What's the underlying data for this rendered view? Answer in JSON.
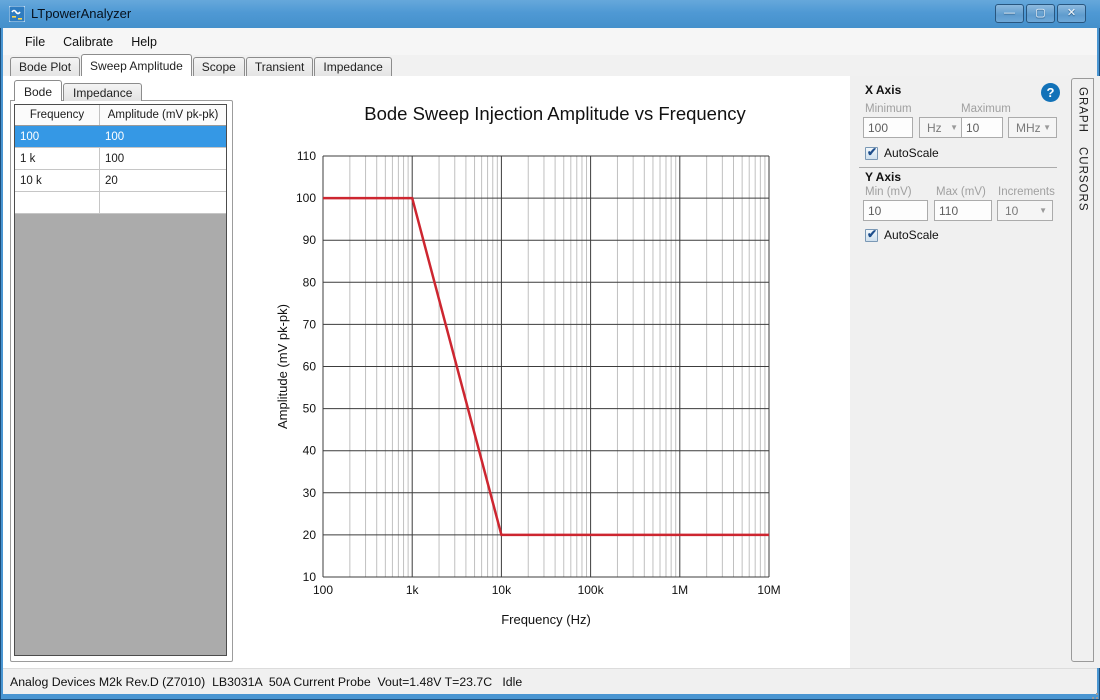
{
  "window": {
    "title": "LTpowerAnalyzer",
    "controls": [
      {
        "name": "minimize",
        "glyph": "—"
      },
      {
        "name": "maximize",
        "glyph": "▢"
      },
      {
        "name": "close",
        "glyph": "✕"
      }
    ]
  },
  "menu": {
    "items": [
      "File",
      "Calibrate",
      "Help"
    ]
  },
  "main_tabs": {
    "items": [
      "Bode Plot",
      "Sweep Amplitude",
      "Scope",
      "Transient",
      "Impedance"
    ],
    "active": "Sweep Amplitude"
  },
  "left_panel": {
    "tabs": [
      "Bode",
      "Impedance"
    ],
    "active_tab": "Bode",
    "table": {
      "headers": [
        "Frequency",
        "Amplitude (mV pk-pk)"
      ],
      "rows": [
        [
          "100",
          "100"
        ],
        [
          "1 k",
          "100"
        ],
        [
          "10 k",
          "20"
        ],
        [
          "",
          ""
        ]
      ],
      "selected_row_index": 0
    }
  },
  "chart_data": {
    "type": "line",
    "title": "Bode Sweep Injection Amplitude vs Frequency",
    "xlabel": "Frequency (Hz)",
    "ylabel": "Amplitude (mV pk-pk)",
    "xscale": "log",
    "xlim": [
      100,
      10000000
    ],
    "ylim": [
      10,
      110
    ],
    "y_increment": 10,
    "xticks": {
      "values": [
        100,
        1000,
        10000,
        100000,
        1000000,
        10000000
      ],
      "labels": [
        "100",
        "1k",
        "10k",
        "100k",
        "1M",
        "10M"
      ]
    },
    "grid": true,
    "legend_position": "none",
    "series": [
      {
        "name": "Injection Amplitude",
        "color": "#cd2630",
        "points": [
          [
            100,
            100
          ],
          [
            1000,
            100
          ],
          [
            10000,
            20
          ],
          [
            10000000,
            20
          ]
        ]
      }
    ]
  },
  "right_panel": {
    "help_icon": "?",
    "x_axis": {
      "title": "X Axis",
      "min_label": "Minimum",
      "min_value": "100",
      "min_unit": "Hz",
      "max_label": "Maximum",
      "max_value": "10",
      "max_unit": "MHz",
      "autoscale_label": "AutoScale",
      "autoscale_checked": true
    },
    "y_axis": {
      "title": "Y Axis",
      "min_label": "Min (mV)",
      "min_value": "10",
      "max_label": "Max (mV)",
      "max_value": "110",
      "increments_label": "Increments",
      "increments_value": "10",
      "autoscale_label": "AutoScale",
      "autoscale_checked": true
    }
  },
  "side_tabs": [
    "GRAPH",
    "CURSORS"
  ],
  "status_bar": {
    "text": "Analog Devices M2k Rev.D (Z7010)  LB3031A  50A Current Probe  Vout=1.48V T=23.7C   Idle"
  },
  "colors": {
    "titlebar": "#4a96d2",
    "selected_row": "#3598e5",
    "series_red": "#cd2630",
    "help_blue": "#1272b8"
  }
}
